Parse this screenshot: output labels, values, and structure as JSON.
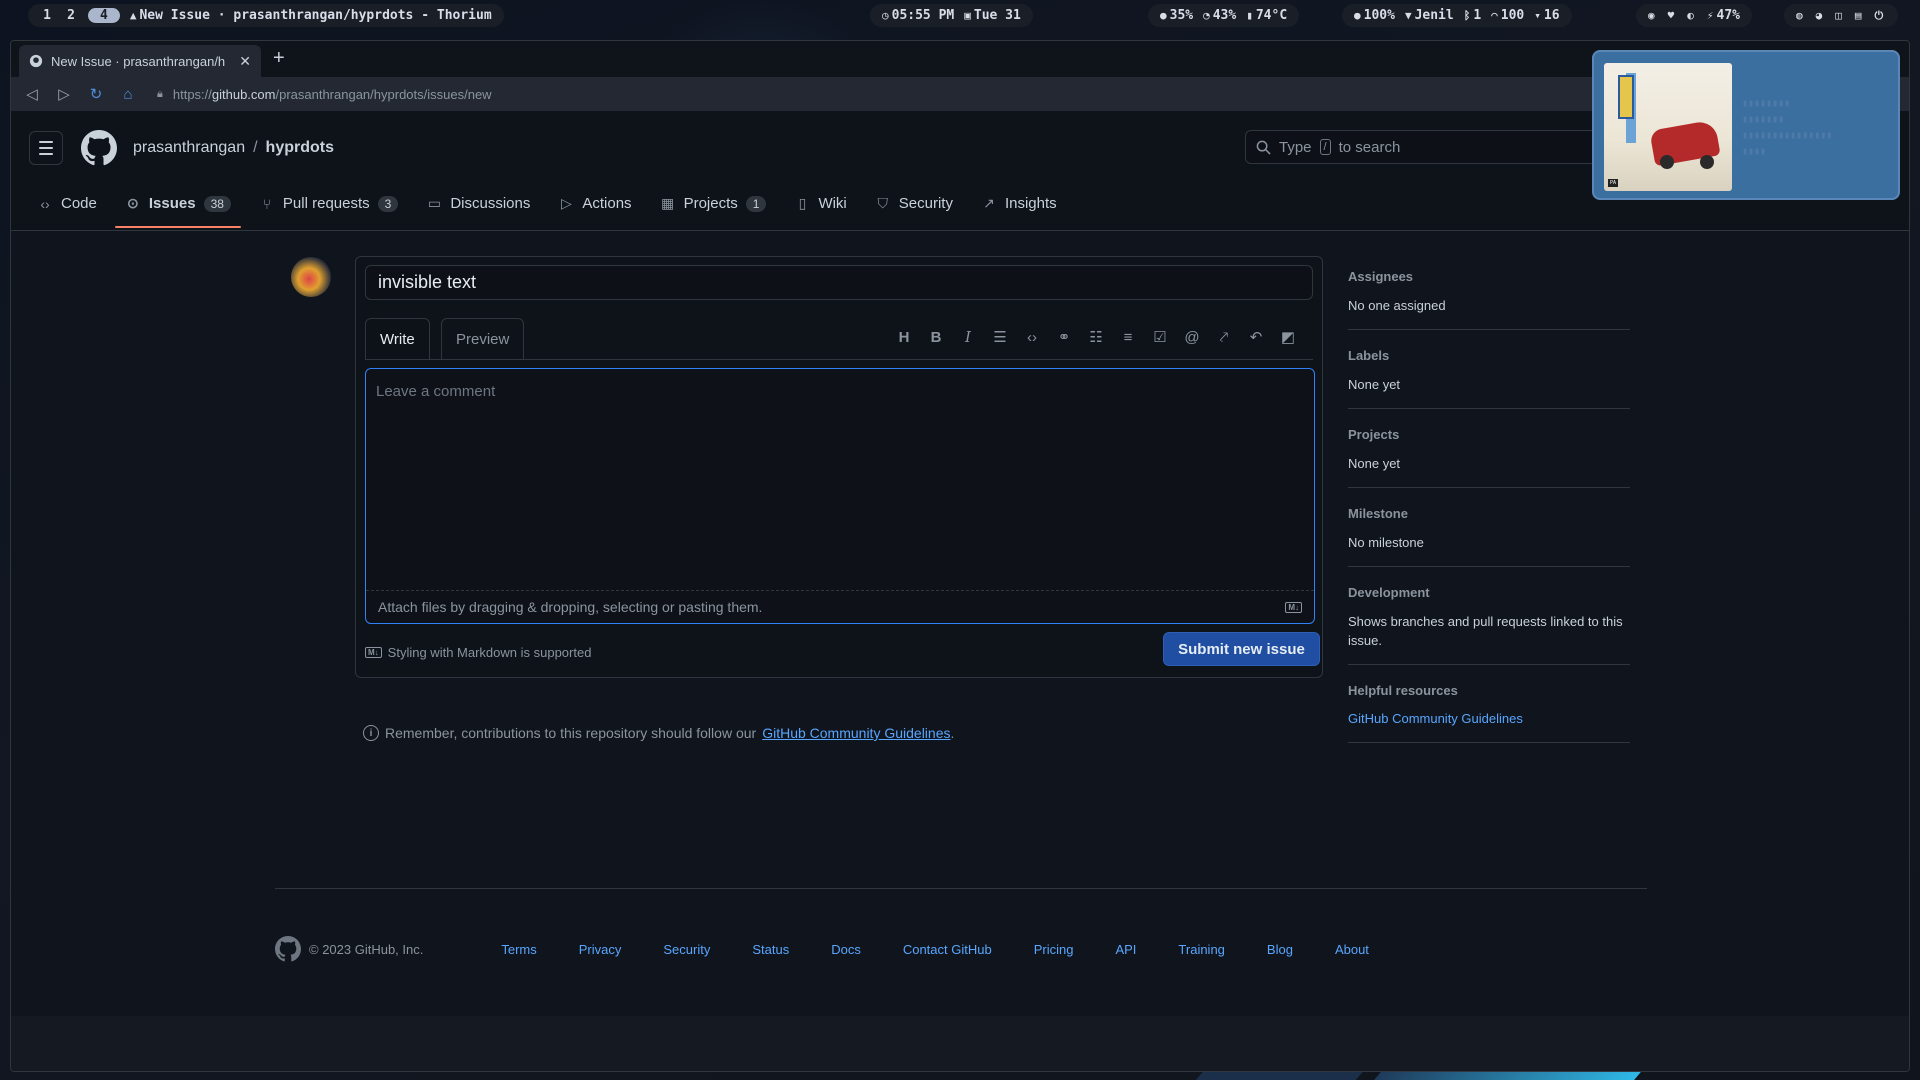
{
  "topbar": {
    "workspaces": [
      "1",
      "2",
      "4"
    ],
    "active_workspace": "4",
    "window_title": "New Issue · prasanthrangan/hyprdots - Thorium",
    "time": "05:55 PM",
    "date": "Tue 31",
    "cpu": "35%",
    "mem": "43%",
    "temp": "74°C",
    "brightness": "100%",
    "wifi": "Jenil",
    "bluetooth": "1",
    "volume": "100",
    "mic": "16",
    "battery": "47%"
  },
  "browser": {
    "tab_title": "New Issue · prasanthrangan/h",
    "url_scheme": "https://",
    "url_domain": "github.com",
    "url_path": "/prasanthrangan/hyprdots/issues/new"
  },
  "header": {
    "owner": "prasanthrangan",
    "separator": "/",
    "repo": "hyprdots",
    "search_prefix": "Type",
    "search_key": "/",
    "search_suffix": "to search"
  },
  "repo_nav": [
    {
      "label": "Code",
      "icon": "code-icon"
    },
    {
      "label": "Issues",
      "count": "38",
      "icon": "issue-icon",
      "selected": true
    },
    {
      "label": "Pull requests",
      "count": "3",
      "icon": "pull-request-icon"
    },
    {
      "label": "Discussions",
      "icon": "discussion-icon"
    },
    {
      "label": "Actions",
      "icon": "play-icon"
    },
    {
      "label": "Projects",
      "count": "1",
      "icon": "table-icon"
    },
    {
      "label": "Wiki",
      "icon": "book-icon"
    },
    {
      "label": "Security",
      "icon": "shield-icon"
    },
    {
      "label": "Insights",
      "icon": "graph-icon"
    }
  ],
  "form": {
    "title_value": "invisible text",
    "write_label": "Write",
    "preview_label": "Preview",
    "comment_placeholder": "Leave a comment",
    "attach_text": "Attach files by dragging & dropping, selecting or pasting them.",
    "styling_note": "Styling with Markdown is supported",
    "submit_label": "Submit new issue",
    "remember_prefix": "Remember, contributions to this repository should follow our",
    "remember_link": "GitHub Community Guidelines",
    "remember_suffix": "."
  },
  "sidebar": {
    "assignees_heading": "Assignees",
    "assignees_value": "No one assigned",
    "labels_heading": "Labels",
    "labels_value": "None yet",
    "projects_heading": "Projects",
    "projects_value": "None yet",
    "milestone_heading": "Milestone",
    "milestone_value": "No milestone",
    "development_heading": "Development",
    "development_value": "Shows branches and pull requests linked to this issue.",
    "resources_heading": "Helpful resources",
    "resources_link": "GitHub Community Guidelines"
  },
  "footer": {
    "copyright": "© 2023 GitHub, Inc.",
    "links": [
      "Terms",
      "Privacy",
      "Security",
      "Status",
      "Docs",
      "Contact GitHub",
      "Pricing",
      "API",
      "Training",
      "Blog",
      "About"
    ]
  },
  "colors": {
    "accent_blue": "#58a6ff",
    "submit_bg": "#1f4ea3",
    "focus_border": "#2f81f7",
    "tab_underline": "#f78166"
  }
}
